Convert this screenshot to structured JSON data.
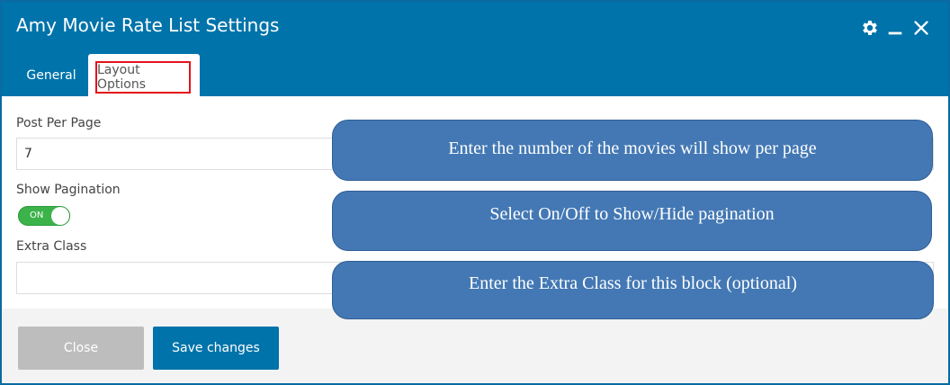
{
  "dialog": {
    "title": "Amy Movie Rate List Settings",
    "icons": [
      "gear-icon",
      "minimize-icon",
      "close-icon"
    ]
  },
  "tabs": [
    {
      "label": "General",
      "active": false
    },
    {
      "label": "Layout Options",
      "active": true
    }
  ],
  "fields": {
    "post_per_page": {
      "label": "Post Per Page",
      "value": "7"
    },
    "show_pagination": {
      "label": "Show Pagination",
      "toggle_text": "ON",
      "on": true
    },
    "extra_class": {
      "label": "Extra Class",
      "value": ""
    }
  },
  "footer": {
    "close_label": "Close",
    "save_label": "Save changes"
  },
  "callouts": [
    "Enter the number of the movies will show per page",
    "Select On/Off to Show/Hide pagination",
    "Enter the Extra Class for this block (optional)"
  ],
  "colors": {
    "header": "#0073aa",
    "highlight": "#e3141b",
    "toggle_on": "#3bb34a",
    "callout": "#4378b4",
    "close_button": "#bdbdbd",
    "save_button": "#0073aa"
  }
}
